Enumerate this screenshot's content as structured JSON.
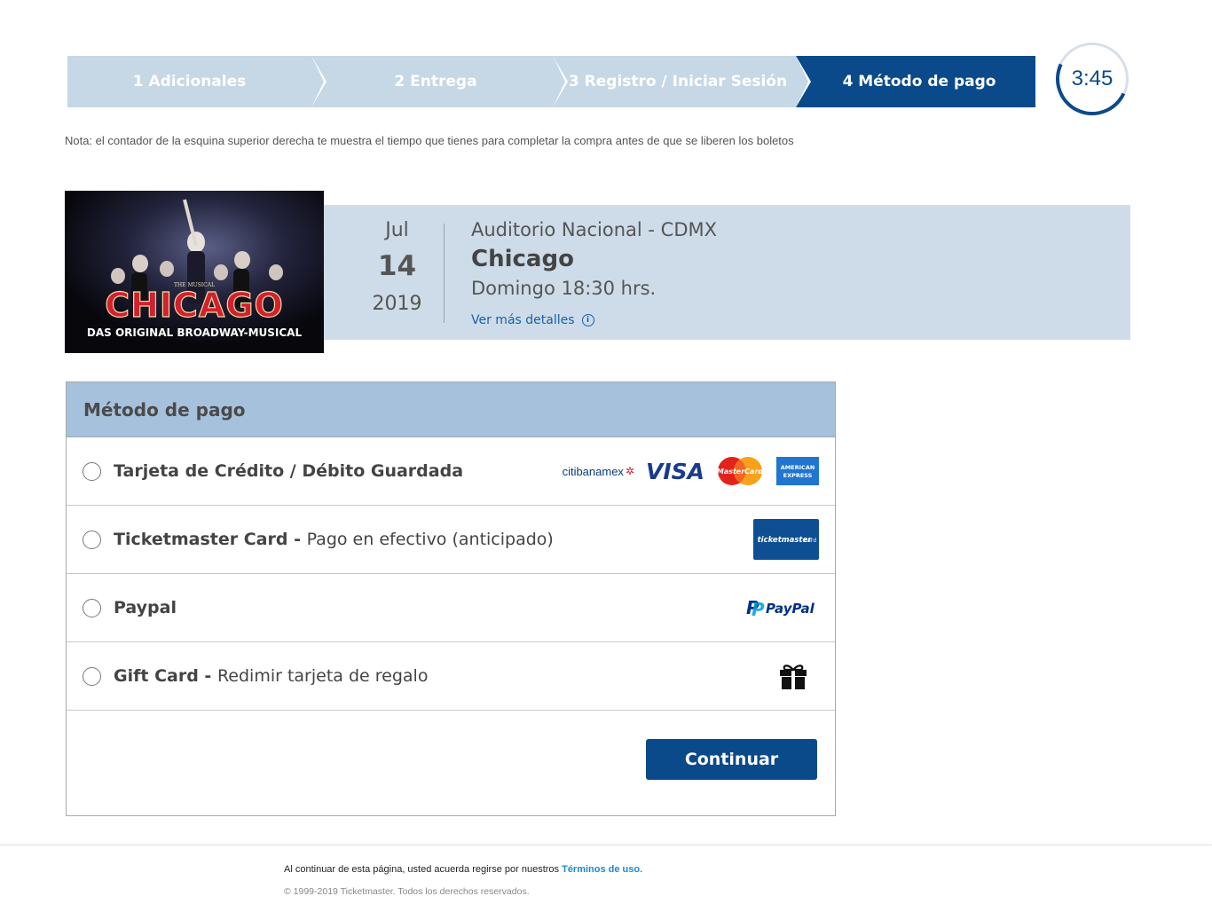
{
  "steps": [
    {
      "label": "1 Adicionales"
    },
    {
      "label": "2 Entrega"
    },
    {
      "label": "3 Registro / Iniciar Sesión"
    },
    {
      "label": "4 Método de pago"
    }
  ],
  "timer": "3:45",
  "note": "Nota: el contador de la esquina superior derecha te muestra el tiempo que tienes para completar la compra antes de que se liberen los boletos",
  "event": {
    "poster_title": "CHICAGO",
    "poster_subtitle": "DAS ORIGINAL BROADWAY-MUSICAL",
    "poster_tag": "THE MUSICAL",
    "month": "Jul",
    "day": "14",
    "year": "2019",
    "venue": "Auditorio Nacional - CDMX",
    "title": "Chicago",
    "when": "Domingo 18:30 hrs.",
    "more": "Ver más detalles"
  },
  "payment": {
    "header": "Método de pago",
    "options": [
      {
        "bold": "Tarjeta de Crédito / Débito Guardada",
        "rest": "",
        "logos": [
          "citibanamex-logo",
          "visa-logo",
          "mastercard-logo",
          "amex-logo"
        ]
      },
      {
        "bold": "Ticketmaster Card - ",
        "rest": "Pago en efectivo (anticipado)",
        "logos": [
          "ticketmaster-card-logo"
        ]
      },
      {
        "bold": "Paypal",
        "rest": "",
        "logos": [
          "paypal-logo"
        ]
      },
      {
        "bold": "Gift Card - ",
        "rest": "Redimir tarjeta de regalo",
        "logos": [
          "gift-icon"
        ]
      }
    ],
    "logo_text": {
      "citibanamex": "citibanamex",
      "visa": "VISA",
      "mastercard": "MasterCard",
      "amex_line1": "AMERICAN",
      "amex_line2": "EXPRESS",
      "tm_card": "ticketmaster",
      "tm_card_suffix": "Card",
      "paypal": "PayPal"
    },
    "continue_label": "Continuar"
  },
  "footer": {
    "text": "Al continuar de esta página, usted acuerda regirse por nuestros ",
    "link": "Términos de uso",
    "after_link": ".",
    "copyright": "© 1999-2019 Ticketmaster. Todos los derechos reservados."
  },
  "colors": {
    "brand": "#0a4a8a",
    "step_inactive": "#c6d7e5",
    "event_band": "#cddce8",
    "panel_header": "#a6c1db"
  }
}
